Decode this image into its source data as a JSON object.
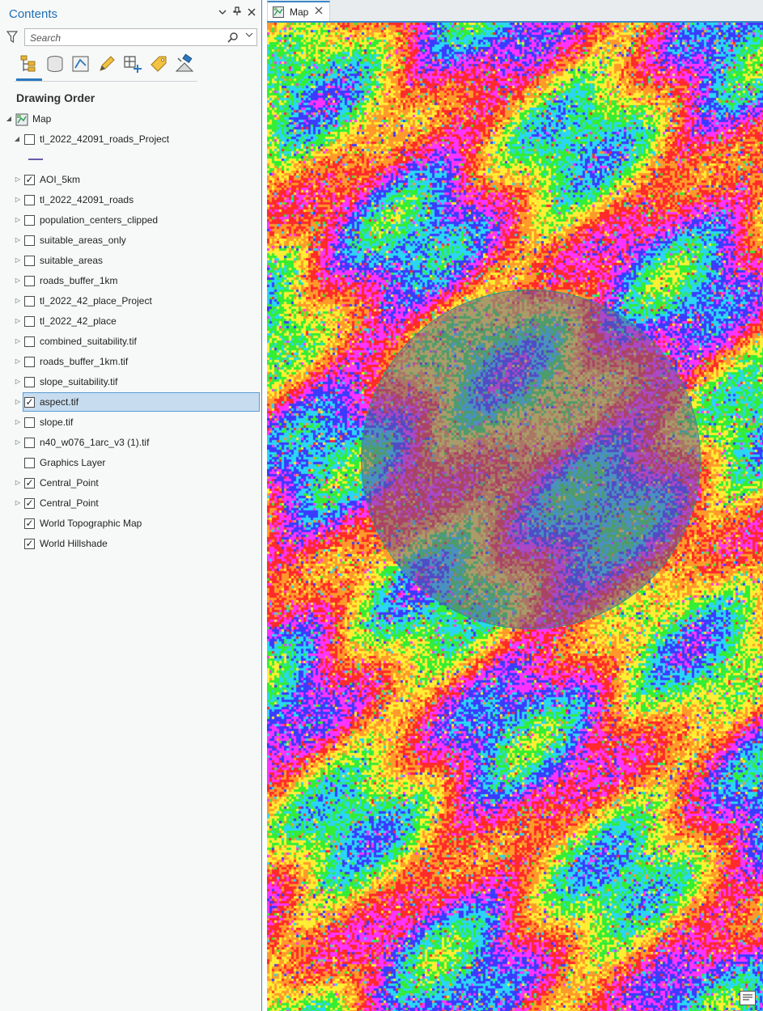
{
  "contents_pane": {
    "title": "Contents",
    "header_buttons": [
      "chevron-down",
      "pin",
      "close"
    ],
    "search": {
      "placeholder": "Search",
      "value": ""
    },
    "toolbar_icons": [
      "list-by-drawing-order-icon",
      "list-by-data-source-icon",
      "list-by-selection-icon",
      "list-by-editing-icon",
      "list-by-snapping-icon",
      "list-by-labeling-icon",
      "list-by-perspective-imagery-icon"
    ],
    "section_title": "Drawing Order",
    "map_node": "Map",
    "layers": [
      {
        "label": "tl_2022_42091_roads_Project",
        "checked": false,
        "expand": "expanded",
        "has_legend": true
      },
      {
        "label": "AOI_5km",
        "checked": true,
        "expand": "collapsed"
      },
      {
        "label": "tl_2022_42091_roads",
        "checked": false,
        "expand": "collapsed"
      },
      {
        "label": "population_centers_clipped",
        "checked": false,
        "expand": "collapsed"
      },
      {
        "label": "suitable_areas_only",
        "checked": false,
        "expand": "collapsed"
      },
      {
        "label": "suitable_areas",
        "checked": false,
        "expand": "collapsed"
      },
      {
        "label": "roads_buffer_1km",
        "checked": false,
        "expand": "collapsed"
      },
      {
        "label": "tl_2022_42_place_Project",
        "checked": false,
        "expand": "collapsed"
      },
      {
        "label": "tl_2022_42_place",
        "checked": false,
        "expand": "collapsed"
      },
      {
        "label": "combined_suitability.tif",
        "checked": false,
        "expand": "collapsed"
      },
      {
        "label": "roads_buffer_1km.tif",
        "checked": false,
        "expand": "collapsed"
      },
      {
        "label": "slope_suitability.tif",
        "checked": false,
        "expand": "collapsed"
      },
      {
        "label": "aspect.tif",
        "checked": true,
        "expand": "collapsed",
        "selected": true
      },
      {
        "label": "slope.tif",
        "checked": false,
        "expand": "collapsed"
      },
      {
        "label": "n40_w076_1arc_v3 (1).tif",
        "checked": false,
        "expand": "collapsed"
      },
      {
        "label": "Graphics Layer",
        "checked": false,
        "expand": "none"
      },
      {
        "label": "Central_Point",
        "checked": true,
        "expand": "collapsed"
      },
      {
        "label": "Central_Point",
        "checked": true,
        "expand": "collapsed"
      },
      {
        "label": "World Topographic Map",
        "checked": true,
        "expand": "none"
      },
      {
        "label": "World Hillshade",
        "checked": true,
        "expand": "none"
      }
    ]
  },
  "map_view": {
    "tab_label": "Map",
    "aspect_palette": [
      "#ff2a2a",
      "#ff9a2a",
      "#ffee33",
      "#33ee33",
      "#2ad6f4",
      "#3b3bff",
      "#ff33ff"
    ],
    "aoi_fill": "#6a5a96"
  },
  "colors": {
    "accent": "#3a86c8",
    "selection": "#c7dcee"
  }
}
